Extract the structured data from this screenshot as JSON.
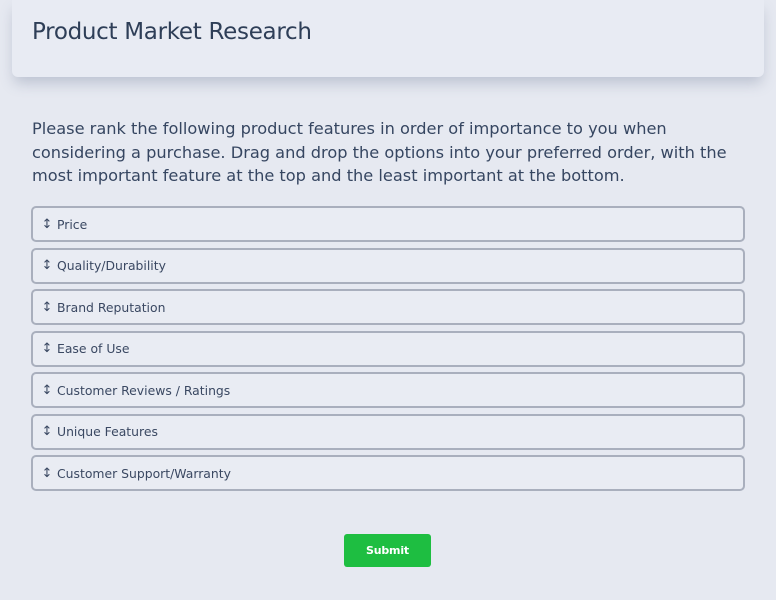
{
  "header": {
    "title": "Product Market Research"
  },
  "instructions": "Please rank the following product features in order of importance to you when considering a purchase. Drag and drop the options into your preferred order, with the most important feature at the top and the least important at the bottom.",
  "ranking": {
    "drag_icon": "drag-handle-icon",
    "items": [
      {
        "label": "Price"
      },
      {
        "label": "Quality/Durability"
      },
      {
        "label": "Brand Reputation"
      },
      {
        "label": "Ease of Use"
      },
      {
        "label": "Customer Reviews / Ratings"
      },
      {
        "label": "Unique Features"
      },
      {
        "label": "Customer Support/Warranty"
      }
    ]
  },
  "submit": {
    "label": "Submit",
    "color": "#1ebe41"
  }
}
